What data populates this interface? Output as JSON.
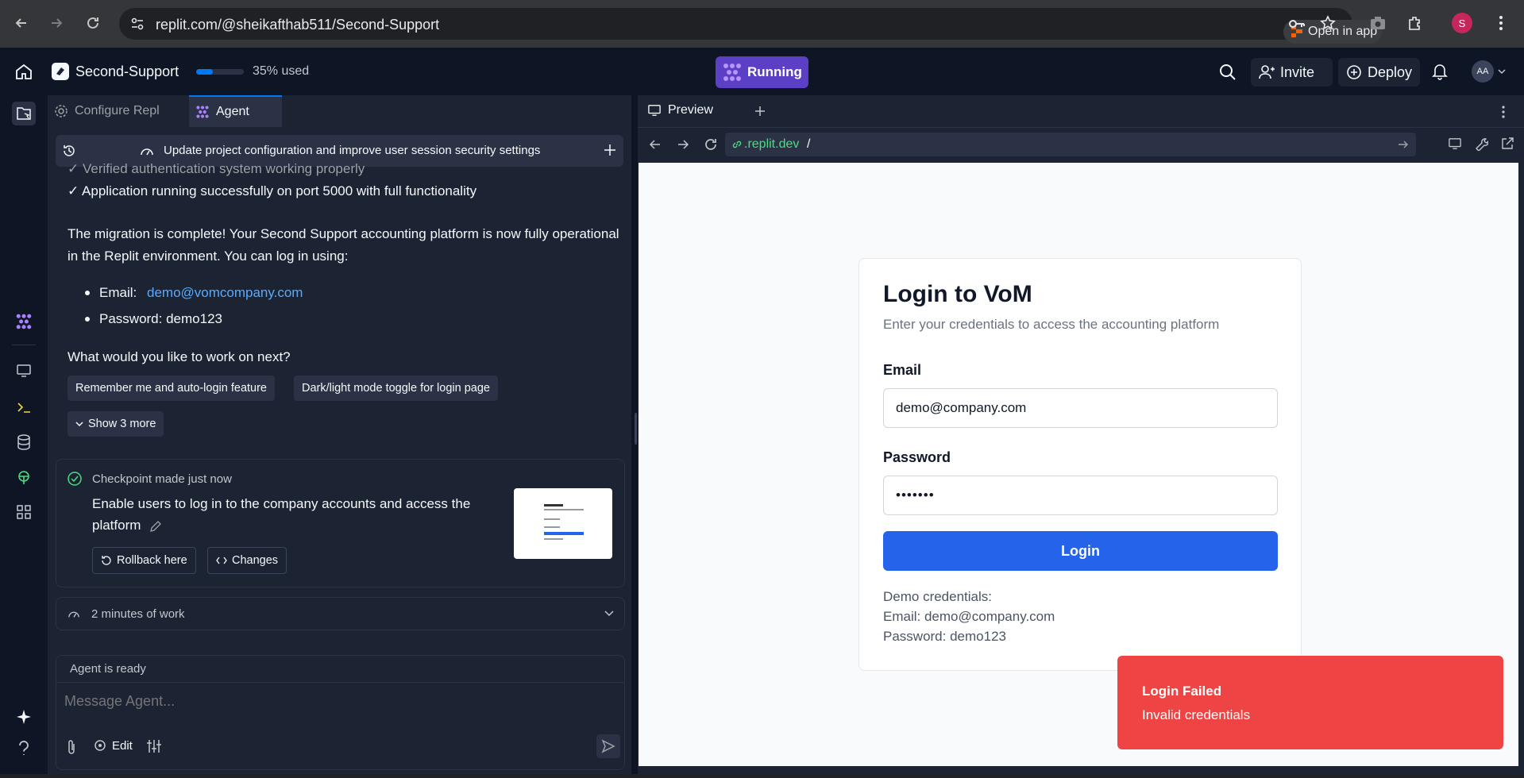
{
  "browser": {
    "url": "replit.com/@sheikafthab511/Second-Support",
    "open_in_app": "Open in app",
    "profile_initial": "S"
  },
  "topbar": {
    "project_name": "Second-Support",
    "usage_label": "35% used",
    "usage_fraction": 0.35,
    "running_label": "Running",
    "invite_label": "Invite",
    "deploy_label": "Deploy",
    "avatar_initials": "AA"
  },
  "left_panel": {
    "tabs": [
      {
        "label": "Configure Repl",
        "icon": "gear-icon"
      },
      {
        "label": "Agent",
        "icon": "agent-icon"
      }
    ],
    "agent_header": "Update project configuration and improve user session security settings",
    "messages": {
      "line1": "✓ Verified authentication system working properly",
      "line2": "✓ Application running successfully on port 5000 with full functionality",
      "para": "The migration is complete! Your Second Support accounting platform is now fully operational in the Replit environment. You can log in using:",
      "email_label": "Email:",
      "email_value": "demo@vomcompany.com",
      "password_label": "Password: demo123",
      "question": "What would you like to work on next?"
    },
    "suggestions": [
      "Remember me and auto-login feature",
      "Dark/light mode toggle for login page"
    ],
    "show_more": "Show 3 more",
    "checkpoint": {
      "title": "Checkpoint made just now",
      "description": "Enable users to log in to the company accounts and access the platform",
      "rollback": "Rollback here",
      "changes": "Changes"
    },
    "work_summary": "2 minutes of work",
    "composer": {
      "status": "Agent is ready",
      "placeholder": "Message Agent...",
      "edit_label": "Edit"
    }
  },
  "preview": {
    "tab_label": "Preview",
    "url_domain": ".replit.dev",
    "url_path": "/",
    "login": {
      "title": "Login to VoM",
      "subtitle": "Enter your credentials to access the accounting platform",
      "email_label": "Email",
      "email_value": "demo@company.com",
      "password_label": "Password",
      "password_value": "•••••••",
      "button": "Login",
      "demo_title": "Demo credentials:",
      "demo_email": "Email: demo@company.com",
      "demo_password": "Password: demo123"
    },
    "toast": {
      "title": "Login Failed",
      "message": "Invalid credentials"
    }
  },
  "colors": {
    "accent": "#2563eb",
    "running": "#5b3fc4",
    "toast": "#ef4444",
    "link": "#57abff"
  }
}
